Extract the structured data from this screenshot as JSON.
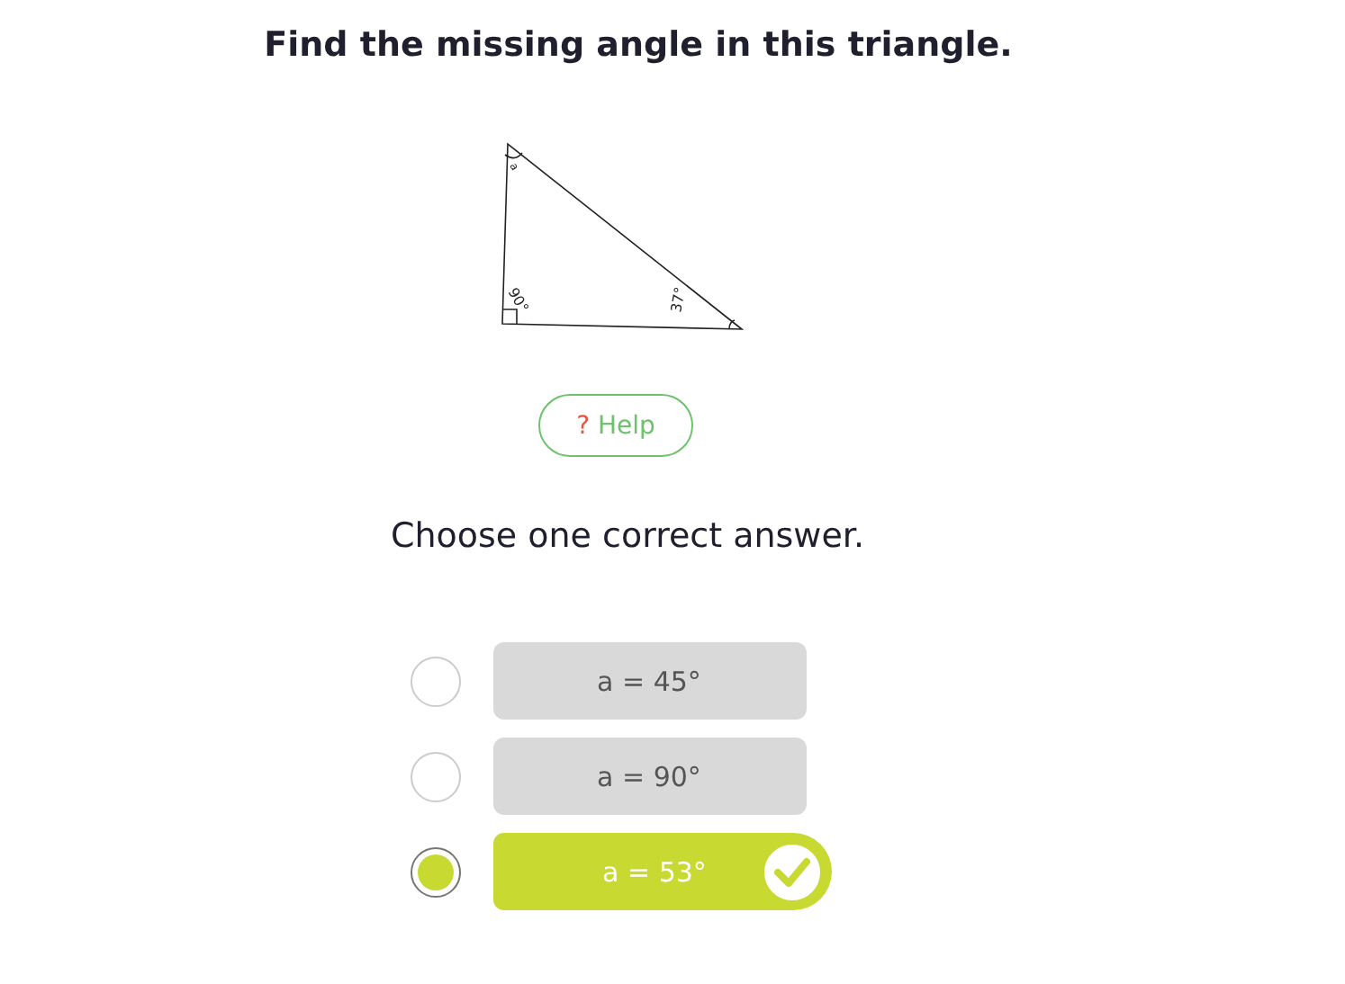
{
  "question": "Find the missing angle in this triangle.",
  "figure": {
    "labels": [
      {
        "kind": "top",
        "text": "a"
      },
      {
        "kind": "right",
        "text": "90°"
      },
      {
        "kind": "bottom",
        "text": "37°"
      }
    ]
  },
  "help": {
    "icon": "?",
    "label": "Help"
  },
  "instruction": "Choose one correct answer.",
  "options": [
    {
      "label": "a = 45°",
      "selected": false,
      "correct": false
    },
    {
      "label": "a = 90°",
      "selected": false,
      "correct": false
    },
    {
      "label": "a = 53°",
      "selected": true,
      "correct": true
    }
  ]
}
